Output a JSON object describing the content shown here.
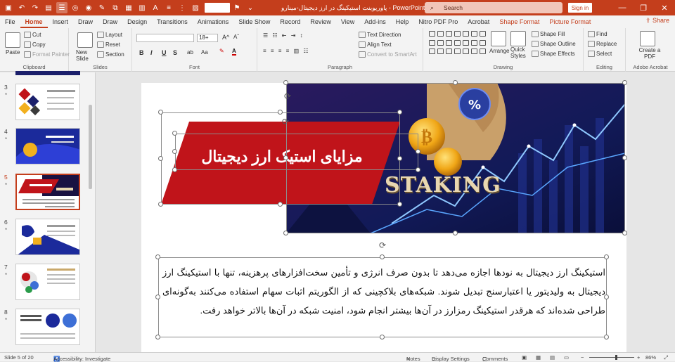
{
  "titlebar": {
    "doc_title": "پاورپوینت استیکینگ در ارز دیجیتال-مینارو  -  PowerPoint",
    "search_placeholder": "Search",
    "signin_label": "Sign in",
    "font_combo": ""
  },
  "tabs": [
    {
      "label": "File"
    },
    {
      "label": "Home"
    },
    {
      "label": "Insert"
    },
    {
      "label": "Draw"
    },
    {
      "label": "Draw"
    },
    {
      "label": "Design"
    },
    {
      "label": "Transitions"
    },
    {
      "label": "Animations"
    },
    {
      "label": "Slide Show"
    },
    {
      "label": "Record"
    },
    {
      "label": "Review"
    },
    {
      "label": "View"
    },
    {
      "label": "Add-ins"
    },
    {
      "label": "Help"
    },
    {
      "label": "Nitro PDF Pro"
    },
    {
      "label": "Acrobat"
    },
    {
      "label": "Shape Format"
    },
    {
      "label": "Picture Format"
    }
  ],
  "share_label": "Share",
  "ribbon": {
    "clipboard": {
      "paste": "Paste",
      "cut": "Cut",
      "copy": "Copy",
      "format_painter": "Format Painter",
      "label": "Clipboard"
    },
    "slides": {
      "new_slide": "New Slide",
      "layout": "Layout",
      "reset": "Reset",
      "section": "Section",
      "label": "Slides"
    },
    "font": {
      "font_name": "",
      "font_size": "18+",
      "bold": "B",
      "italic": "I",
      "underline": "U",
      "strike": "S",
      "label": "Font"
    },
    "paragraph": {
      "text_direction": "Text Direction",
      "align_text": "Align Text",
      "smartart": "Convert to SmartArt",
      "label": "Paragraph"
    },
    "drawing": {
      "arrange": "Arrange",
      "quick_styles": "Quick Styles",
      "shape_fill": "Shape Fill",
      "shape_outline": "Shape Outline",
      "shape_effects": "Shape Effects",
      "label": "Drawing"
    },
    "editing": {
      "find": "Find",
      "replace": "Replace",
      "select": "Select",
      "label": "Editing"
    },
    "acrobat": {
      "create_pdf": "Create a PDF",
      "label": "Adobe Acrobat"
    }
  },
  "thumbnails": [
    {
      "num": "3",
      "star": "*"
    },
    {
      "num": "4",
      "star": "*"
    },
    {
      "num": "5",
      "star": "*"
    },
    {
      "num": "6",
      "star": "*"
    },
    {
      "num": "7",
      "star": "*"
    },
    {
      "num": "8",
      "star": "*"
    }
  ],
  "slide": {
    "title": "مزایای استیک ارز دیجیتال",
    "staking_word": "STAKING",
    "body": "استیکینگ ارز دیجیتال به نودها اجازه می‌دهد تا بدون صرف انرژی و تأمین سخت‌افزارهای پرهزینه، تنها با استیکینگ ارز دیجیتال به ولیدیتور یا اعتبارسنج تبدیل شوند. شبکه‌های بلاکچینی که از الگوریتم اثبات سهام استفاده می‌کنند به‌گونه‌ای طراحی شده‌اند که هرقدر استیکینگ رمزارز در آن‌ها بیشتر انجام شود، امنیت شبکه در آن‌ها بالاتر خواهد رفت."
  },
  "status": {
    "slide_of": "Slide 5 of 20",
    "accessibility": "Accessibility: Investigate",
    "notes": "Notes",
    "display": "Display Settings",
    "comments": "Comments",
    "zoom": "86%"
  },
  "colors": {
    "accent": "#c43e1c",
    "title_red": "#c0141a"
  }
}
